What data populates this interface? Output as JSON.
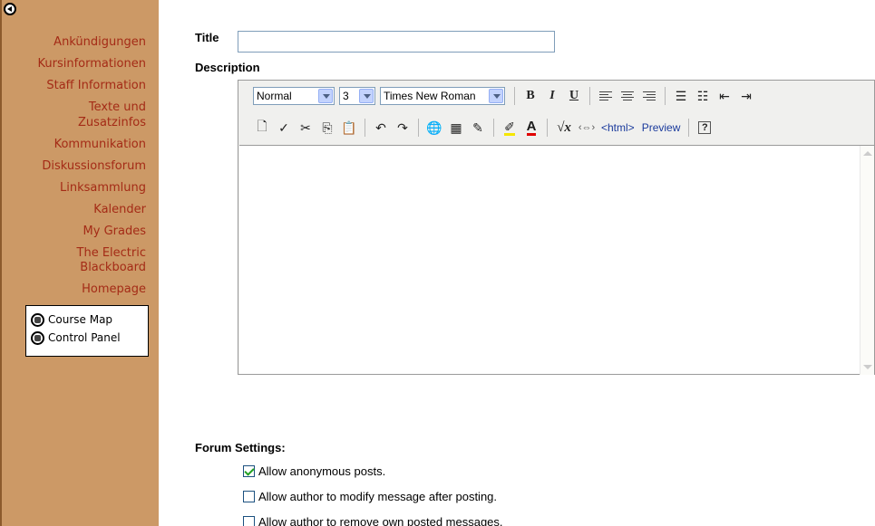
{
  "sidebar": {
    "nav_items": [
      {
        "id": "ankuendigungen",
        "label": "Ankündigungen"
      },
      {
        "id": "kursinformationen",
        "label": "Kursinformationen"
      },
      {
        "id": "staff-information",
        "label": "Staff Information"
      },
      {
        "id": "texte-und-zusatzinfos",
        "label": "Texte und Zusatzinfos"
      },
      {
        "id": "kommunikation",
        "label": "Kommunikation"
      },
      {
        "id": "diskussionsforum",
        "label": "Diskussionsforum"
      },
      {
        "id": "linksammlung",
        "label": "Linksammlung"
      },
      {
        "id": "kalender",
        "label": "Kalender"
      },
      {
        "id": "my-grades",
        "label": "My Grades"
      },
      {
        "id": "the-electric-blackboard",
        "label": "The Electric Blackboard"
      },
      {
        "id": "homepage",
        "label": "Homepage"
      }
    ],
    "tools": [
      {
        "id": "course-map",
        "label": "Course Map"
      },
      {
        "id": "control-panel",
        "label": "Control Panel"
      }
    ]
  },
  "form": {
    "title_label": "Title",
    "title_value": "",
    "description_label": "Description",
    "forum_settings_label": "Forum Settings:",
    "options": [
      {
        "label": "Allow anonymous posts.",
        "checked": true
      },
      {
        "label": "Allow author to modify message after posting.",
        "checked": false
      },
      {
        "label": "Allow author to remove own posted messages.",
        "checked": false
      }
    ]
  },
  "editor": {
    "format_value": "Normal",
    "size_value": "3",
    "font_value": "Times New Roman",
    "bold": "B",
    "italic": "I",
    "underline": "U",
    "html_label": "<html>",
    "preview_label": "Preview",
    "help_label": "?",
    "equation_label": "√x",
    "font_color_label": "A"
  }
}
